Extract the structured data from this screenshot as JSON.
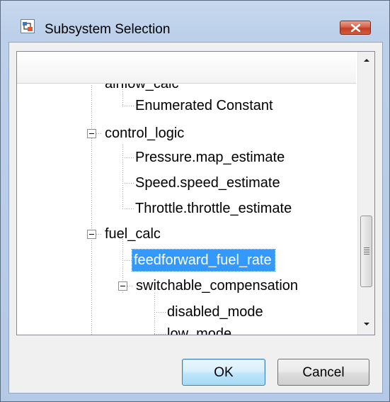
{
  "window": {
    "title": "Subsystem Selection",
    "icon": "simulink-subsystem-icon",
    "close_icon": "close-icon"
  },
  "tree": {
    "nodes": [
      {
        "label": "airflow_calc",
        "expanded": true
      },
      {
        "label": "Enumerated Constant"
      },
      {
        "label": "control_logic",
        "expanded": true
      },
      {
        "label": "Pressure.map_estimate"
      },
      {
        "label": "Speed.speed_estimate"
      },
      {
        "label": "Throttle.throttle_estimate"
      },
      {
        "label": "fuel_calc",
        "expanded": true
      },
      {
        "label": "feedforward_fuel_rate",
        "selected": true
      },
      {
        "label": "switchable_compensation",
        "expanded": true
      },
      {
        "label": "disabled_mode"
      },
      {
        "label": "low_mode"
      }
    ]
  },
  "scrollbar": {
    "position_fraction": 0.72
  },
  "buttons": {
    "ok_label": "OK",
    "cancel_label": "Cancel"
  },
  "colors": {
    "selection": "#3399ff",
    "titlebar": "#bcd0ea",
    "close_button": "#c33f22"
  }
}
